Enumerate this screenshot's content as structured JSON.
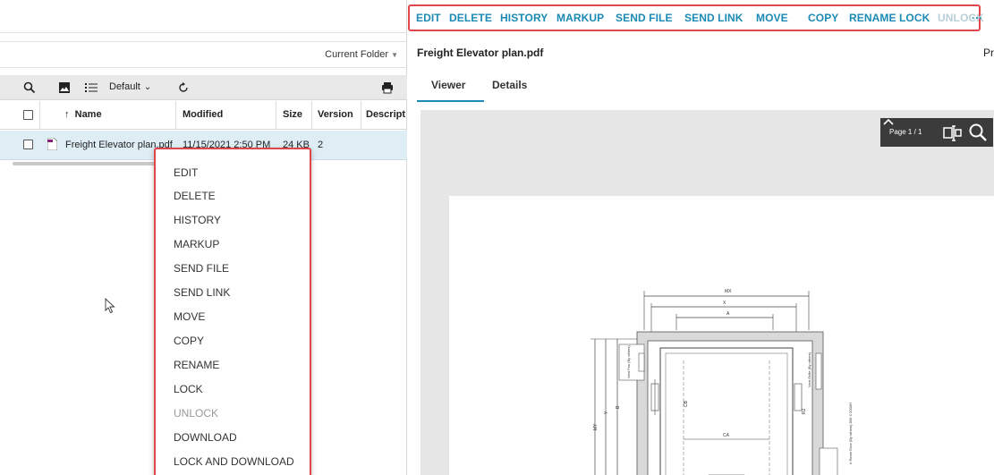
{
  "left_panel": {
    "folder_select": "Current Folder",
    "view_selector": "Default",
    "columns": [
      "Name",
      "Modified",
      "Size",
      "Version",
      "Descript"
    ],
    "file_row": {
      "name": "Freight Elevator plan.pdf",
      "modified": "11/15/2021 2:50 PM",
      "size": "24 KB",
      "version": "2"
    }
  },
  "context_menu": {
    "items": [
      {
        "label": "EDIT",
        "disabled": false
      },
      {
        "label": "DELETE",
        "disabled": false
      },
      {
        "label": "HISTORY",
        "disabled": false
      },
      {
        "label": "MARKUP",
        "disabled": false
      },
      {
        "label": "SEND FILE",
        "disabled": false
      },
      {
        "label": "SEND LINK",
        "disabled": false
      },
      {
        "label": "MOVE",
        "disabled": false
      },
      {
        "label": "COPY",
        "disabled": false
      },
      {
        "label": "RENAME",
        "disabled": false
      },
      {
        "label": "LOCK",
        "disabled": false
      },
      {
        "label": "UNLOCK",
        "disabled": true
      },
      {
        "label": "DOWNLOAD",
        "disabled": false
      },
      {
        "label": "LOCK AND DOWNLOAD",
        "disabled": false
      }
    ]
  },
  "action_bar": {
    "items": [
      {
        "label": "EDIT",
        "disabled": false
      },
      {
        "label": "DELETE",
        "disabled": false
      },
      {
        "label": "HISTORY",
        "disabled": false
      },
      {
        "label": "MARKUP",
        "disabled": false
      },
      {
        "label": "SEND FILE",
        "disabled": false
      },
      {
        "label": "SEND LINK",
        "disabled": false
      },
      {
        "label": "MOVE",
        "disabled": false
      },
      {
        "label": "COPY",
        "disabled": false
      },
      {
        "label": "RENAME",
        "disabled": false
      },
      {
        "label": "LOCK",
        "disabled": false
      },
      {
        "label": "UNLOCK",
        "disabled": true
      }
    ],
    "more": "···"
  },
  "viewer": {
    "title": "Freight Elevator plan.pdf",
    "truncated_right": "Pr",
    "tabs": [
      "Viewer",
      "Details"
    ],
    "page_info": "Page 1 / 1"
  },
  "drawing": {
    "dim_labels": [
      "MX",
      "X",
      "A",
      "CB",
      "CA",
      "B",
      "Y",
      "MY",
      "R2"
    ],
    "notes": [
      "Vent Fan (By others)",
      "Vent Grille (By others)",
      "e Room Door (By others) 800 X 2000H"
    ]
  },
  "colors": {
    "accent": "#1b8ab4",
    "highlight_border": "#e0474c",
    "row_selected": "#dfeef5",
    "toolbar_bg": "#e9e9e9",
    "viewer_bg": "#e6e6e6"
  }
}
